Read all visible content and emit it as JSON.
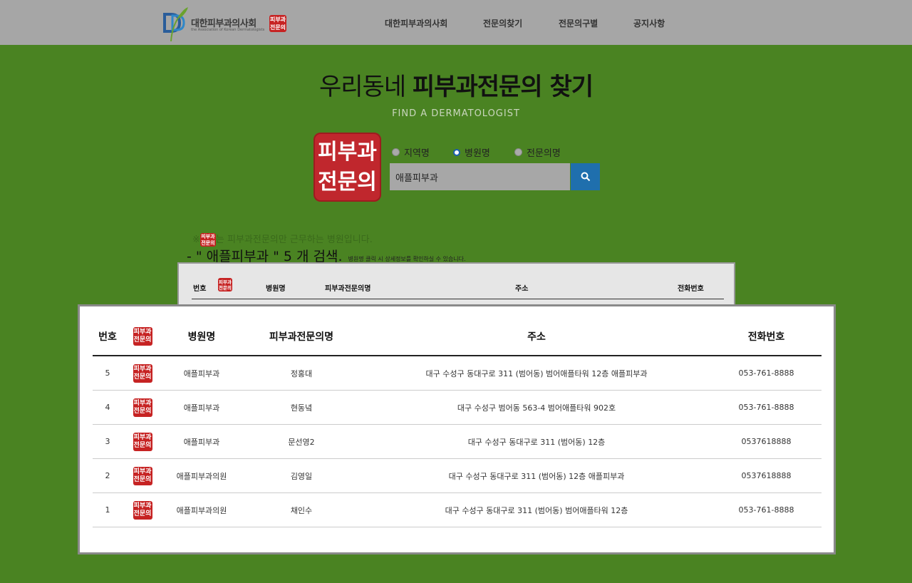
{
  "header": {
    "logo_name": "대한피부과의사회",
    "logo_sub": "the Association of Korean Dermatologists",
    "logo_badge": [
      "피부과",
      "전문의"
    ],
    "nav": [
      "대한피부과의사회",
      "전문의찾기",
      "전문의구별",
      "공지사항"
    ]
  },
  "search": {
    "title_light": "우리동네 ",
    "title_bold": "피부과전문의 찾기",
    "subtitle": "FIND A DERMATOLOGIST",
    "badge": [
      "피부과",
      "전문의"
    ],
    "radios": [
      {
        "label": "지역명",
        "checked": false
      },
      {
        "label": "병원명",
        "checked": true
      },
      {
        "label": "전문의명",
        "checked": false
      }
    ],
    "query": "애플피부과",
    "button_icon": "search-icon"
  },
  "notice": {
    "prefix": "※",
    "badge": [
      "피부과",
      "전문의"
    ],
    "text": "는 피부과전문의만 근무하는 병원입니다.",
    "result": "- \" 애플피부과 \" 5 개 검색.",
    "hint": "병원명 클릭 시 상세정보를 확인하실 수 있습니다."
  },
  "table": {
    "badge": [
      "피부과",
      "전문의"
    ],
    "columns": [
      "번호",
      "병원명",
      "피부과전문의명",
      "주소",
      "전화번호"
    ],
    "rows": [
      {
        "no": "5",
        "hospital": "애플피부과",
        "doctor": "정홍대",
        "address": "대구 수성구 동대구로 311 (범어동) 범어애플타워 12층 애플피부과",
        "phone": "053-761-8888"
      },
      {
        "no": "4",
        "hospital": "애플피부과",
        "doctor": "현동녘",
        "address": "대구 수성구 범어동 563-4 범어애플타워 902호",
        "phone": "053-761-8888"
      },
      {
        "no": "3",
        "hospital": "애플피부과",
        "doctor": "문선영2",
        "address": "대구 수성구 동대구로 311 (범어동) 12층",
        "phone": "0537618888"
      },
      {
        "no": "2",
        "hospital": "애플피부과의원",
        "doctor": "김영일",
        "address": "대구 수성구 동대구로 311 (범어동) 12층 애플피부과",
        "phone": "0537618888"
      },
      {
        "no": "1",
        "hospital": "애플피부과의원",
        "doctor": "채인수",
        "address": "대구 수성구 동대구로 311 (범어동) 범어애플타워 12층",
        "phone": "053-761-8888"
      }
    ]
  },
  "colors": {
    "background": "#4a8322",
    "header": "#a6a6a6",
    "badge_red": "#c62323",
    "search_button": "#1f6fad"
  }
}
